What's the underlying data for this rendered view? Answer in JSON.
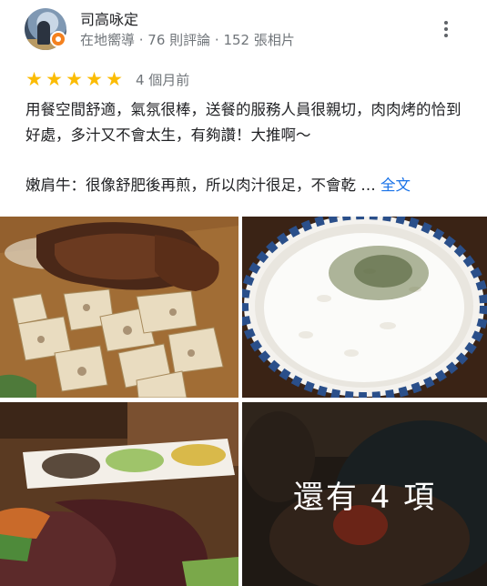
{
  "reviewer": {
    "name": "司高咏定",
    "meta": "在地嚮導 · 76 則評論 · 152 張相片"
  },
  "rating": {
    "stars": 5,
    "max": 5,
    "time": "4 個月前"
  },
  "review": {
    "text": "用餐空間舒適，氣氛很棒，送餐的服務人員很親切，肉肉烤的恰到好處，多汁又不會太生，有夠讚！大推啊～",
    "snippet": "嫩肩牛：很像舒肥後再煎，所以肉汁很足，不會乾 …",
    "full_link": "全文"
  },
  "photos": {
    "more_label": "還有 4 項"
  },
  "colors": {
    "star": "#fbbc04",
    "link": "#1a73e8",
    "guide_badge": "#f4811f",
    "meta_text": "#70757a"
  },
  "icons": {
    "more": "more-vert-icon",
    "star": "star-icon",
    "guide": "local-guide-icon"
  }
}
